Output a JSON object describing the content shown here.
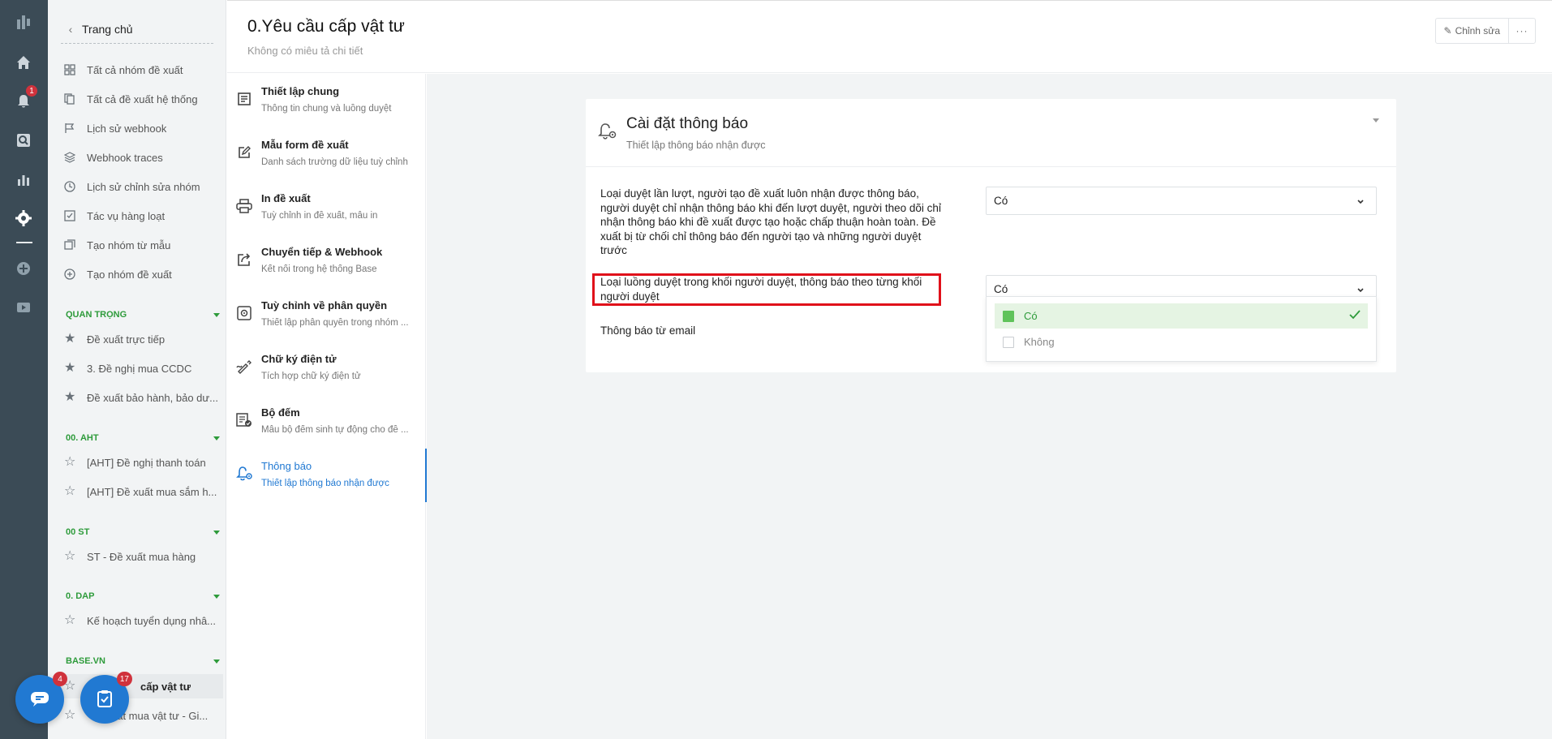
{
  "app": {
    "title": "0.Yêu cầu cấp vật tư",
    "subtitle": "Không có miêu tả chi tiết"
  },
  "rail": {
    "notification_count": "1"
  },
  "header": {
    "edit_label": "Chỉnh sửa",
    "more_label": "···"
  },
  "nav": {
    "home_label": "Trang chủ",
    "items": [
      {
        "label": "Tất cả nhóm đề xuất",
        "icon": "grid-icon"
      },
      {
        "label": "Tất cả đề xuất hệ thống",
        "icon": "copy-icon"
      },
      {
        "label": "Lịch sử webhook",
        "icon": "flag-icon"
      },
      {
        "label": "Webhook traces",
        "icon": "layers-icon"
      },
      {
        "label": "Lịch sử chỉnh sửa nhóm",
        "icon": "clock-icon"
      },
      {
        "label": "Tác vụ hàng loạt",
        "icon": "checklist-icon"
      },
      {
        "label": "Tạo nhóm từ mẫu",
        "icon": "template-icon"
      },
      {
        "label": "Tạo nhóm đề xuất",
        "icon": "plus-circle-icon"
      }
    ],
    "groups": [
      {
        "title": "QUAN TRỌNG",
        "items": [
          "Đề xuất trực tiếp",
          "3. Đề nghị mua CCDC",
          "Đề xuất bảo hành, bảo dư..."
        ]
      },
      {
        "title": "00. AHT",
        "items": [
          "[AHT] Đề nghị thanh toán",
          "[AHT] Đề xuất mua sắm h..."
        ]
      },
      {
        "title": "00 ST",
        "items": [
          "ST - Đề xuất mua hàng"
        ]
      },
      {
        "title": "0. DAP",
        "items": [
          "Kế hoạch tuyển dụng nhâ..."
        ]
      },
      {
        "title": "BASE.VN",
        "items": [
          "cấp vật tư",
          "uất mua vật tư - Gi..."
        ]
      }
    ]
  },
  "settings_menu": [
    {
      "title": "Thiết lập chung",
      "desc": "Thông tin chung và luồng duyệt",
      "icon": "document-icon"
    },
    {
      "title": "Mẫu form đề xuất",
      "desc": "Danh sách trường dữ liệu tuỳ chỉnh",
      "icon": "edit-icon"
    },
    {
      "title": "In đề xuất",
      "desc": "Tuỳ chỉnh in đề xuất, mẫu in",
      "icon": "printer-icon"
    },
    {
      "title": "Chuyển tiếp & Webhook",
      "desc": "Kết nối trong hệ thống Base",
      "icon": "share-icon"
    },
    {
      "title": "Tuỳ chỉnh về phân quyền",
      "desc": "Thiết lập phân quyền trong nhóm ...",
      "icon": "settings-box-icon"
    },
    {
      "title": "Chữ ký điện tử",
      "desc": "Tích hợp chữ ký điện tử",
      "icon": "signature-icon"
    },
    {
      "title": "Bộ đếm",
      "desc": "Mẫu bộ đếm sinh tự động cho đề ...",
      "icon": "counter-icon"
    },
    {
      "title": "Thông báo",
      "desc": "Thiết lập thông báo nhận được",
      "icon": "bell-gear-icon"
    }
  ],
  "card": {
    "title": "Cài đặt thông báo",
    "subtitle": "Thiết lập thông báo nhận được",
    "rows": [
      {
        "label": "Loại duyệt lần lượt, người tạo đề xuất luôn nhận được thông báo, người duyệt chỉ nhận thông báo khi đến lượt duyệt, người theo dõi chỉ nhận thông báo khi đề xuất được tạo hoặc chấp thuận hoàn toàn. Đề xuất bị từ chối chỉ thông báo đến người tạo và những người duyệt trước",
        "value": "Có"
      },
      {
        "label": "Loại luồng duyệt trong khối người duyệt, thông báo theo từng khối người duyệt",
        "value": "Có"
      },
      {
        "label": "Thông báo từ email",
        "value": ""
      }
    ],
    "dropdown_options": [
      "Có",
      "Không"
    ]
  },
  "fabs": {
    "chat_count": "4",
    "task_count": "17"
  },
  "colors": {
    "accent": "#2179d2",
    "green": "#2e9b3b",
    "highlight": "#e0101a",
    "rail": "#3b4b56"
  }
}
